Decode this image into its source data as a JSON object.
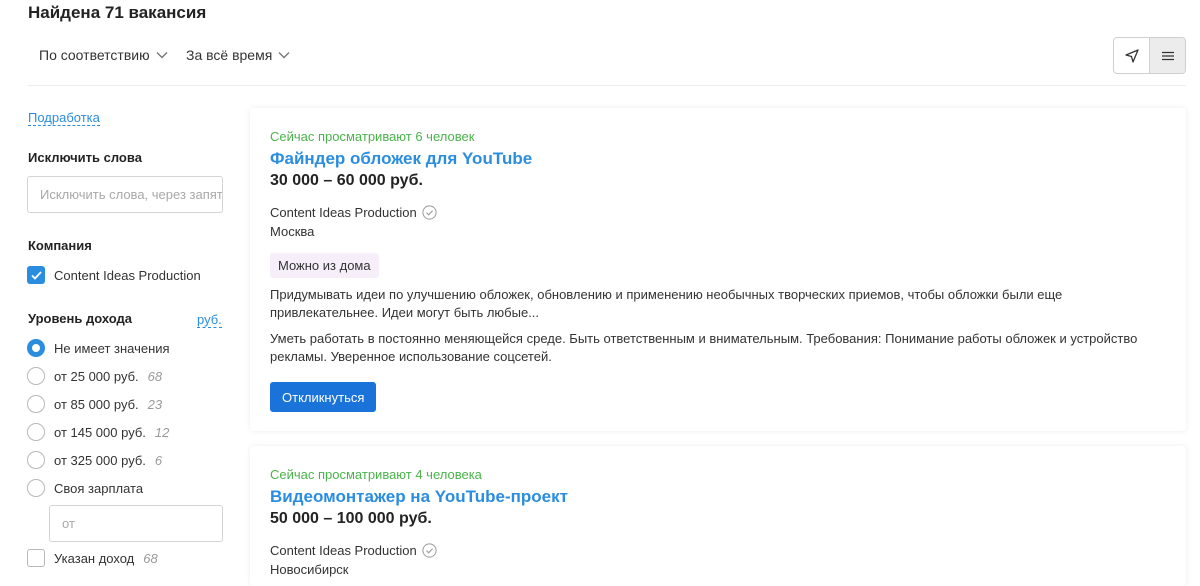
{
  "header": {
    "title": "Найдена 71 вакансия",
    "sort_label": "По соответствию",
    "period_label": "За всё время"
  },
  "sidebar": {
    "part_time_link": "Подработка",
    "exclude_heading": "Исключить слова",
    "exclude_placeholder": "Исключить слова, через запятую",
    "company_heading": "Компания",
    "company_option": "Content Ideas Production",
    "salary_heading": "Уровень дохода",
    "salary_currency": "руб.",
    "salary_options": [
      {
        "label": "Не имеет значения",
        "count": ""
      },
      {
        "label": "от 25 000 руб.",
        "count": "68"
      },
      {
        "label": "от 85 000 руб.",
        "count": "23"
      },
      {
        "label": "от 145 000 руб.",
        "count": "12"
      },
      {
        "label": "от 325 000 руб.",
        "count": "6"
      },
      {
        "label": "Своя зарплата",
        "count": ""
      }
    ],
    "own_salary_placeholder": "от",
    "salary_specified_label": "Указан доход",
    "salary_specified_count": "68"
  },
  "vacancies": [
    {
      "views": "Сейчас просматривают 6 человек",
      "title": "Файндер обложек для YouTube",
      "salary": "30 000 – 60 000 руб.",
      "company": "Content Ideas Production",
      "city": "Москва",
      "badge": "Можно из дома",
      "description": "Придумывать идеи по улучшению обложек, обновлению и применению необычных творческих приемов, чтобы обложки были еще привлекательнее. Идеи могут быть любые...",
      "requirements": "Уметь работать в постоянно меняющейся среде. Быть ответственным и внимательным. Требования: Понимание работы обложек и устройство рекламы. Уверенное использование соцсетей.",
      "apply_label": "Откликнуться"
    },
    {
      "views": "Сейчас просматривают 4 человека",
      "title": "Видеомонтажер на YouTube-проект",
      "salary": "50 000 – 100 000 руб.",
      "company": "Content Ideas Production",
      "city": "Новосибирск"
    }
  ],
  "colors": {
    "accent": "#2b8de0",
    "button": "#1a73d9",
    "views_green": "#4bb34b",
    "badge_bg": "#f6effa"
  },
  "icons": {
    "location": "location-arrow-icon",
    "list": "list-icon",
    "verified": "verified-check-icon",
    "chevron": "chevron-down-icon"
  }
}
